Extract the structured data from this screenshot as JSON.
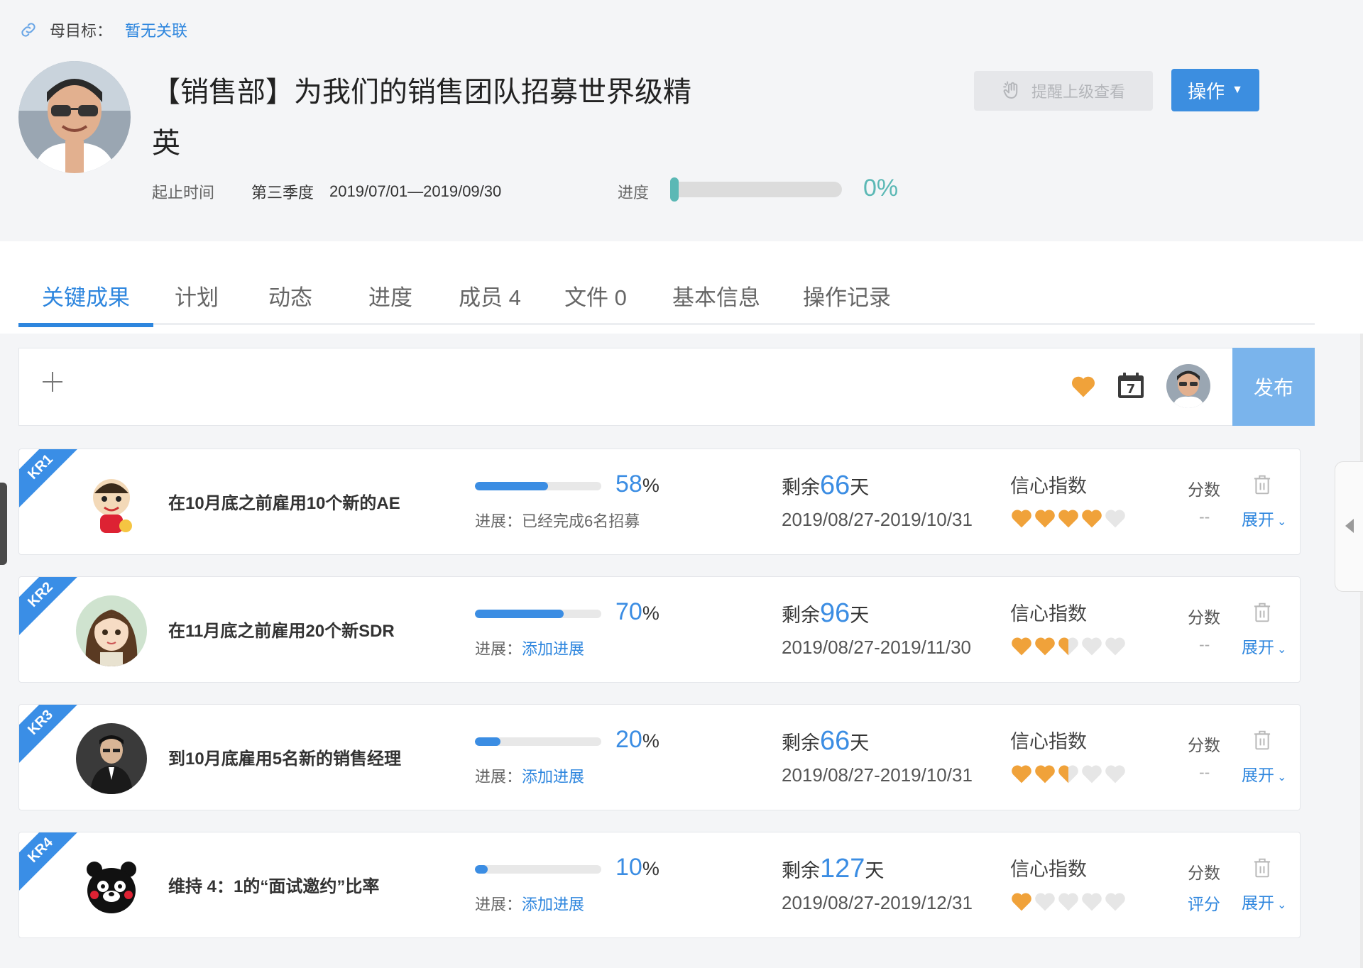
{
  "parent": {
    "label": "母目标：",
    "value": "暂无关联"
  },
  "objective": {
    "title": "【销售部】为我们的销售团队招募世界级精英",
    "period_label": "起止时间",
    "quarter": "第三季度",
    "range": "2019/07/01—2019/09/30",
    "progress_label": "进度",
    "progress_pct": "0%",
    "progress_value": 0
  },
  "actions": {
    "remind": "提醒上级查看",
    "operate": "操作"
  },
  "tabs": [
    {
      "label": "关键成果",
      "active": true
    },
    {
      "label": "计划"
    },
    {
      "label": "动态"
    },
    {
      "label": "进度"
    },
    {
      "label": "成员 4"
    },
    {
      "label": "文件 0"
    },
    {
      "label": "基本信息"
    },
    {
      "label": "操作记录"
    }
  ],
  "composer": {
    "publish": "发布",
    "calendar_day": "7"
  },
  "krs": [
    {
      "tag": "KR1",
      "name": "在10月底之前雇用10个新的AE",
      "pct": "58",
      "pct_unit": "%",
      "progress_value": 0.58,
      "prog_label": "进展：",
      "prog_value": "已经完成6名招募",
      "prog_link": false,
      "remain_pre": "剩余",
      "remain_n": "66",
      "remain_post": "天",
      "dates": "2019/08/27-2019/10/31",
      "conf_label": "信心指数",
      "confidence": 4,
      "score_label": "分数",
      "score_value": "--",
      "score_link": false,
      "expand": "展开"
    },
    {
      "tag": "KR2",
      "name": "在11月底之前雇用20个新SDR",
      "pct": "70",
      "pct_unit": "%",
      "progress_value": 0.7,
      "prog_label": "进展：",
      "prog_value": "添加进展",
      "prog_link": true,
      "remain_pre": "剩余",
      "remain_n": "96",
      "remain_post": "天",
      "dates": "2019/08/27-2019/11/30",
      "conf_label": "信心指数",
      "confidence": 2.5,
      "score_label": "分数",
      "score_value": "--",
      "score_link": false,
      "expand": "展开"
    },
    {
      "tag": "KR3",
      "name": "到10月底雇用5名新的销售经理",
      "pct": "20",
      "pct_unit": "%",
      "progress_value": 0.2,
      "prog_label": "进展：",
      "prog_value": "添加进展",
      "prog_link": true,
      "remain_pre": "剩余",
      "remain_n": "66",
      "remain_post": "天",
      "dates": "2019/08/27-2019/10/31",
      "conf_label": "信心指数",
      "confidence": 2.5,
      "score_label": "分数",
      "score_value": "--",
      "score_link": false,
      "expand": "展开"
    },
    {
      "tag": "KR4",
      "name": "维持 4：1的“面试邀约”比率",
      "pct": "10",
      "pct_unit": "%",
      "progress_value": 0.1,
      "prog_label": "进展：",
      "prog_value": "添加进展",
      "prog_link": true,
      "remain_pre": "剩余",
      "remain_n": "127",
      "remain_post": "天",
      "dates": "2019/08/27-2019/12/31",
      "conf_label": "信心指数",
      "confidence": 1,
      "score_label": "分数",
      "score_value": "评分",
      "score_link": true,
      "expand": "展开"
    }
  ],
  "colors": {
    "accent": "#2e86de",
    "teal": "#5bb8b5",
    "heart": "#f0a23a",
    "heart_empty": "#e6e6e6"
  }
}
